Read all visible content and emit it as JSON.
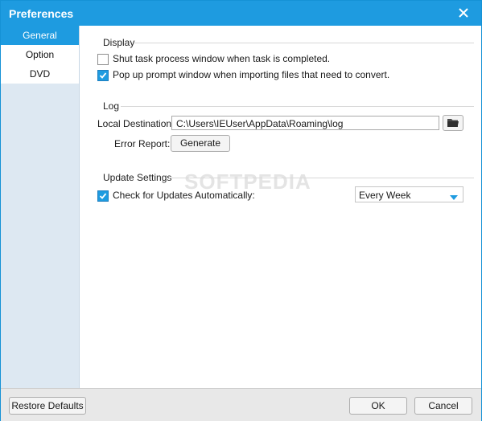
{
  "window": {
    "title": "Preferences"
  },
  "sidebar": {
    "items": [
      {
        "label": "General"
      },
      {
        "label": "Option"
      },
      {
        "label": "DVD"
      }
    ]
  },
  "display": {
    "title": "Display",
    "shut_task_label": "Shut task process window when task is completed.",
    "shut_task_checked": false,
    "popup_label": "Pop up prompt window when importing files that need to convert.",
    "popup_checked": true
  },
  "log": {
    "title": "Log",
    "dest_label": "Local Destination:",
    "dest_value": "C:\\Users\\IEUser\\AppData\\Roaming\\log",
    "error_label": "Error Report:",
    "generate_label": "Generate"
  },
  "update": {
    "title": "Update Settings",
    "check_label": "Check for Updates Automatically:",
    "check_checked": true,
    "frequency": "Every Week"
  },
  "watermark": "SOFTPEDIA",
  "footer": {
    "restore_label": "Restore Defaults",
    "ok_label": "OK",
    "cancel_label": "Cancel"
  },
  "colors": {
    "accent": "#1e9be0",
    "sidebar_bg": "#dde8f2"
  }
}
